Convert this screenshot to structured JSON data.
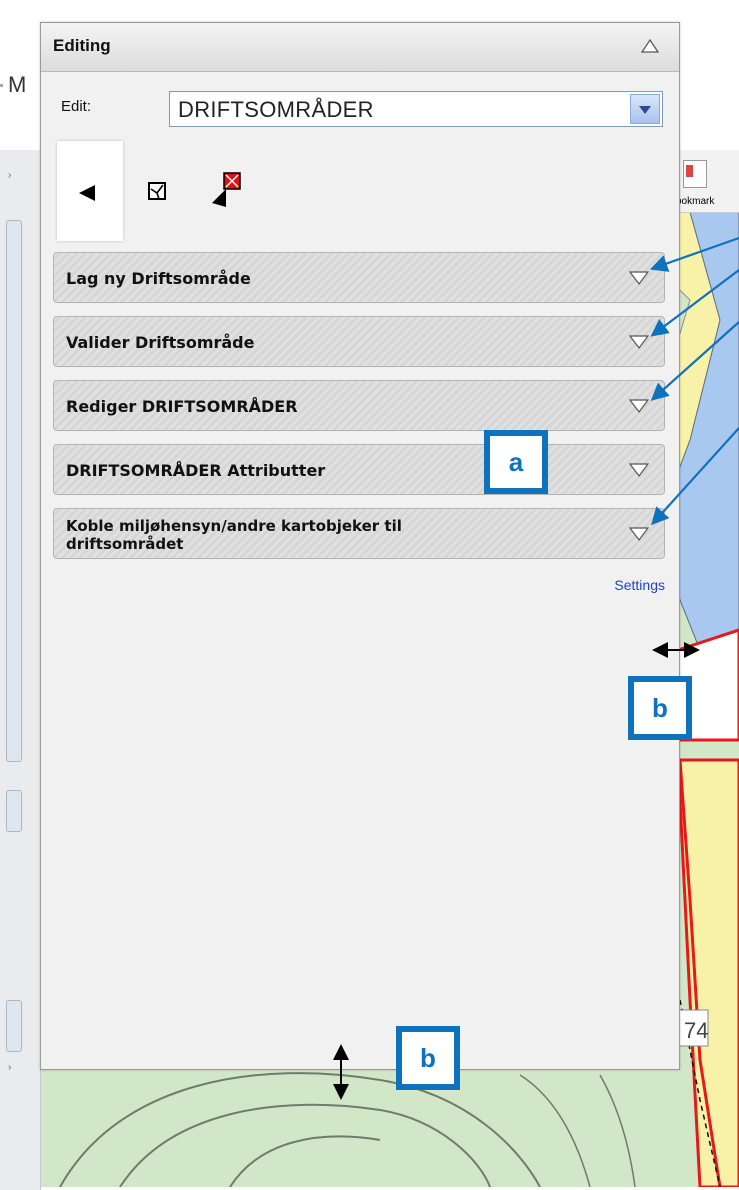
{
  "background": {
    "partial_title": "M",
    "toolbar": {
      "bookmark_label": "ookmark"
    },
    "map_label_fragment": "74"
  },
  "panel": {
    "title": "Editing",
    "edit_label": "Edit:",
    "layer_value": "DRIFTSOMRÅDER",
    "tools": [
      {
        "name": "select-arrow",
        "active": true
      },
      {
        "name": "edit-vertices",
        "active": false
      },
      {
        "name": "create-feature",
        "active": false
      }
    ],
    "sections": [
      {
        "label": "Lag ny Driftsområde"
      },
      {
        "label": "Valider Driftsområde"
      },
      {
        "label": "Rediger DRIFTSOMRÅDER"
      },
      {
        "label": "DRIFTSOMRÅDER Attributter"
      },
      {
        "label_line1": "Koble miljøhensyn/andre kartobjeker til",
        "label_line2": "driftsområdet"
      }
    ],
    "settings_link": "Settings"
  },
  "annotations": {
    "a": "a",
    "b_right": "b",
    "b_bottom": "b",
    "accent": "#0e72bd"
  },
  "colors": {
    "map_river": "#a8c8f0",
    "map_yellow": "#f7f2a8",
    "map_green": "#d2e6c8",
    "boundary_red": "#e81818"
  }
}
